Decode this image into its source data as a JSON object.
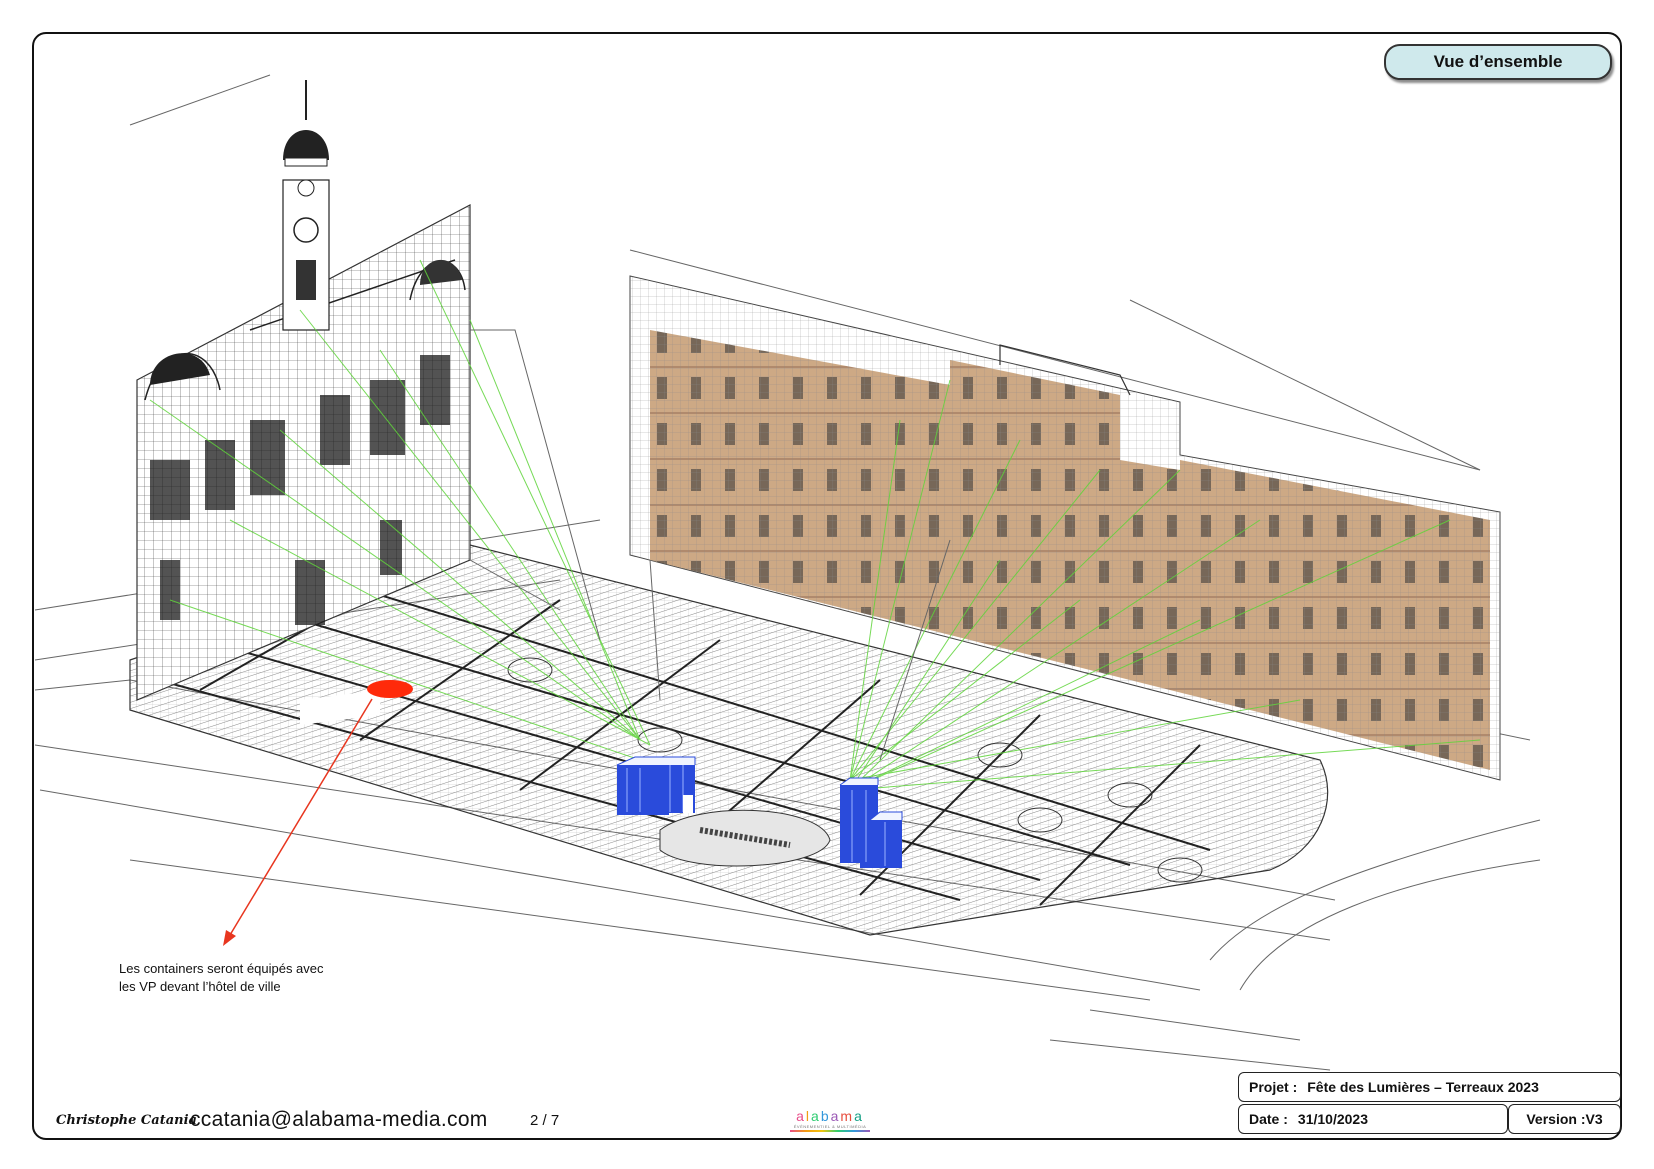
{
  "header": {
    "view_title": "Vue d’ensemble"
  },
  "annotation": {
    "line1": "Les containers seront équipés avec",
    "line2": "les VP devant l’hôtel de ville"
  },
  "title_block": {
    "project_label": "Projet :",
    "project_value": "Fête des Lumières – Terreaux 2023",
    "date_label": "Date :",
    "date_value": "31/10/2023",
    "version": "Version :V3"
  },
  "footer": {
    "author": "Christophe Catania",
    "email": "ccatania@alabama-media.com",
    "page": "2 / 7",
    "logo_text": [
      "a",
      "l",
      "a",
      "b",
      "a",
      "m",
      "a"
    ],
    "logo_tagline": "ÉVÈNEMENTIEL & MULTIMÉDIA"
  },
  "colors": {
    "badge_fill": "#cfe9ec",
    "projector_container": "#2a4bdb",
    "projection_line": "#5fd43a",
    "marker": "#ff2a0a",
    "facade_stone": "#c9a27a"
  }
}
